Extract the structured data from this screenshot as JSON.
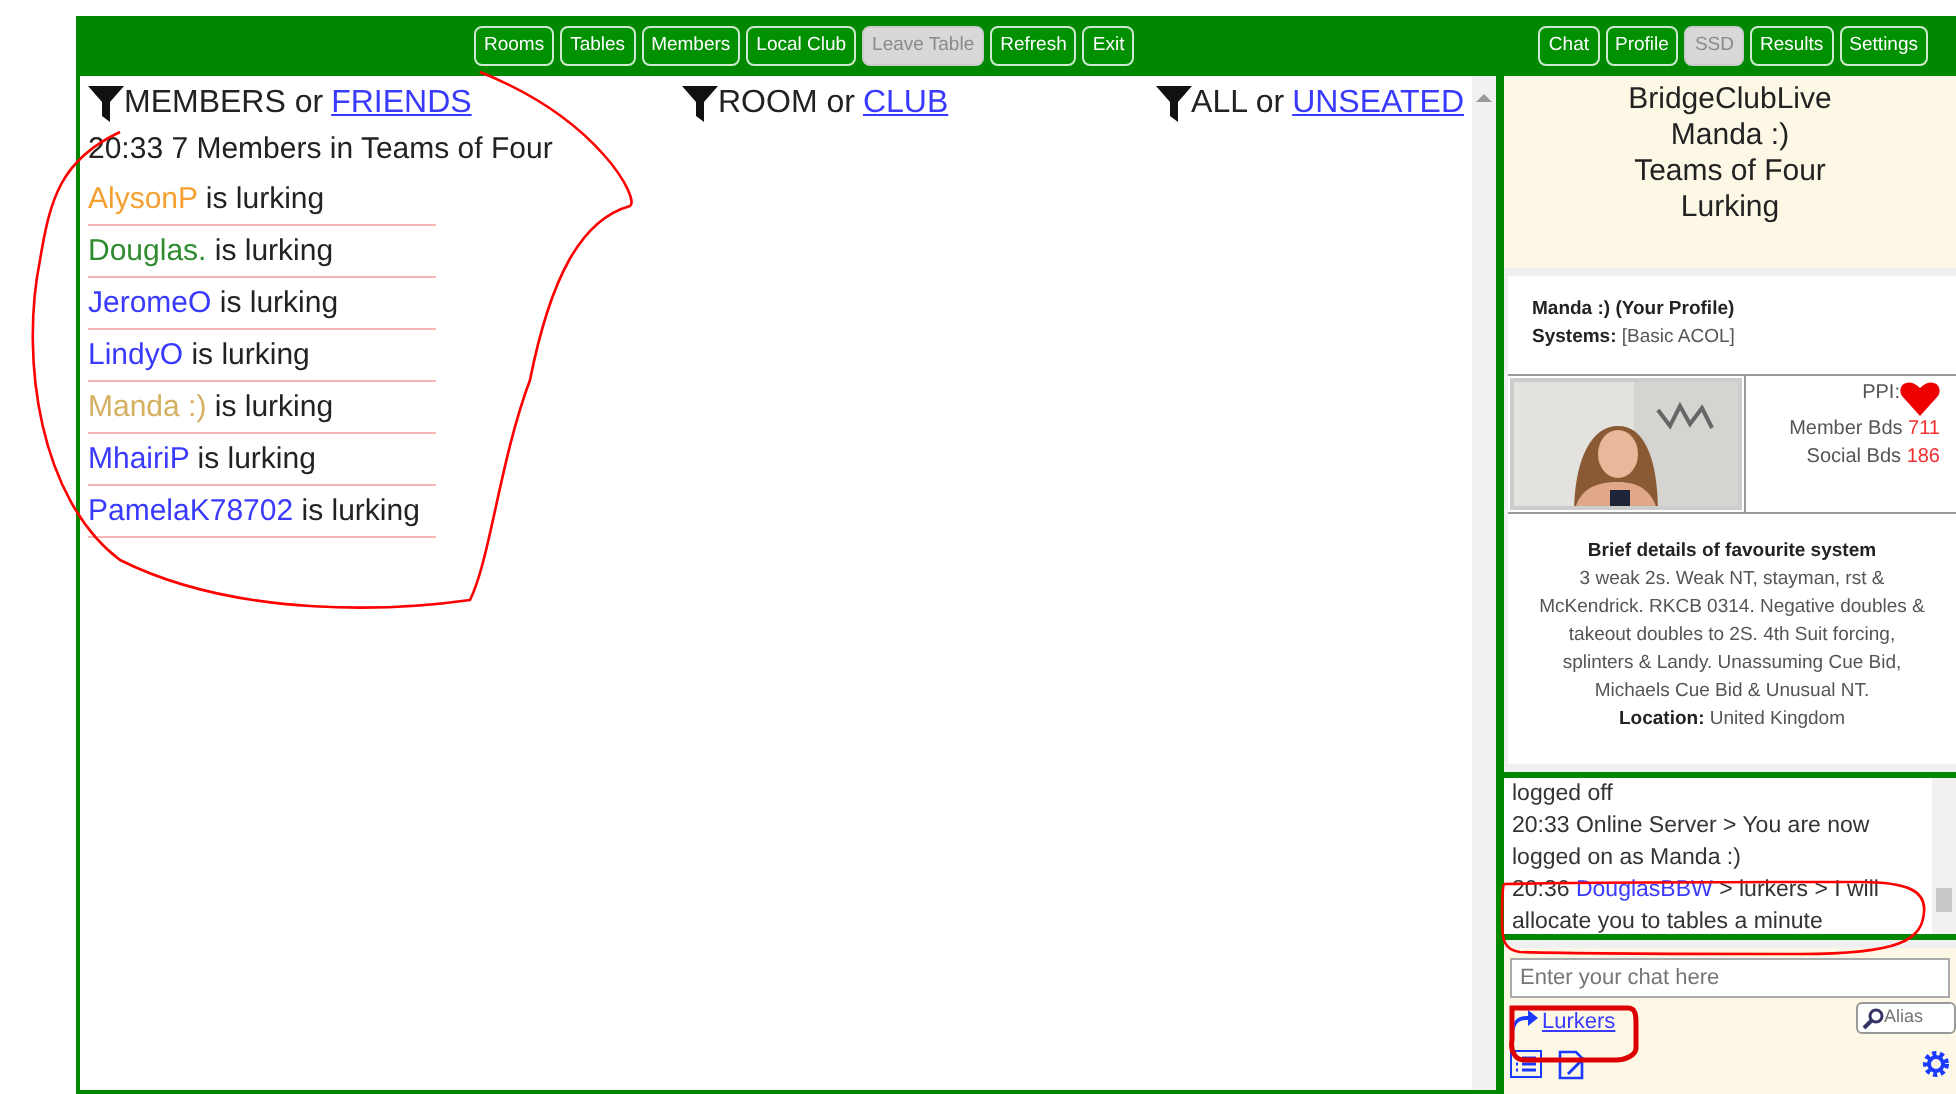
{
  "toolbar_left": [
    {
      "label": "Rooms",
      "disabled": false
    },
    {
      "label": "Tables",
      "disabled": false
    },
    {
      "label": "Members",
      "disabled": false
    },
    {
      "label": "Local Club",
      "disabled": false
    },
    {
      "label": "Leave Table",
      "disabled": true
    },
    {
      "label": "Refresh",
      "disabled": false
    },
    {
      "label": "Exit",
      "disabled": false
    }
  ],
  "toolbar_right": [
    {
      "label": "Chat",
      "disabled": false
    },
    {
      "label": "Profile",
      "disabled": false
    },
    {
      "label": "SSD",
      "disabled": true
    },
    {
      "label": "Results",
      "disabled": false
    },
    {
      "label": "Settings",
      "disabled": false
    }
  ],
  "filters": [
    {
      "first": "MEMBERS",
      "or": "or",
      "second": "FRIENDS"
    },
    {
      "first": "ROOM",
      "or": "or",
      "second": "CLUB"
    },
    {
      "first": "ALL",
      "or": "or",
      "second": "UNSEATED"
    }
  ],
  "members_header": "20:33 7 Members in Teams of Four",
  "members": [
    {
      "name": "AlysonP",
      "status": "is lurking",
      "color": "#f5a030"
    },
    {
      "name": "Douglas.",
      "status": "is lurking",
      "color": "#2e8b2e"
    },
    {
      "name": "JeromeO",
      "status": "is lurking",
      "color": "#3a3aff"
    },
    {
      "name": "LindyO",
      "status": "is lurking",
      "color": "#3a3aff"
    },
    {
      "name": "Manda :)",
      "status": "is lurking",
      "color": "#d4b060"
    },
    {
      "name": "MhairiP",
      "status": "is lurking",
      "color": "#3a3aff"
    },
    {
      "name": "PamelaK78702",
      "status": "is lurking",
      "color": "#3a3aff"
    }
  ],
  "club_info": [
    "BridgeClubLive",
    "Manda :)",
    "Teams of Four",
    "Lurking"
  ],
  "profile": {
    "title": "Manda :) (Your Profile)",
    "systems_label": "Systems:",
    "systems_value": "[Basic ACOL]",
    "ppi_label": "PPI:",
    "member_bds_label": "Member Bds",
    "member_bds": "711",
    "social_bds_label": "Social Bds",
    "social_bds": "186",
    "system_heading": "Brief details of favourite system",
    "system_text": "3 weak 2s. Weak NT, stayman, rst & McKendrick. RKCB 0314. Negative doubles & takeout doubles to 2S. 4th Suit forcing, splinters & Landy. Unassuming Cue Bid, Michaels Cue Bid & Unusual NT.",
    "location_label": "Location:",
    "location_value": "United Kingdom"
  },
  "chat": [
    {
      "text": "logged off"
    },
    {
      "time": "20:33",
      "text": "Online Server > You are now logged on as Manda :)"
    },
    {
      "time": "20:36",
      "user": "DouglasBBW",
      "text": "> lurkers > I will allocate you to tables a minute"
    }
  ],
  "chat_input": {
    "placeholder": "Enter your chat here"
  },
  "recipient": "Lurkers",
  "alias": {
    "placeholder": "Alias"
  },
  "annotations": [
    {
      "kind": "members-loop",
      "color": "#ff0000"
    },
    {
      "kind": "chat-loop",
      "color": "#ff0000"
    },
    {
      "kind": "lurkers-box",
      "color": "#dd0000"
    }
  ]
}
